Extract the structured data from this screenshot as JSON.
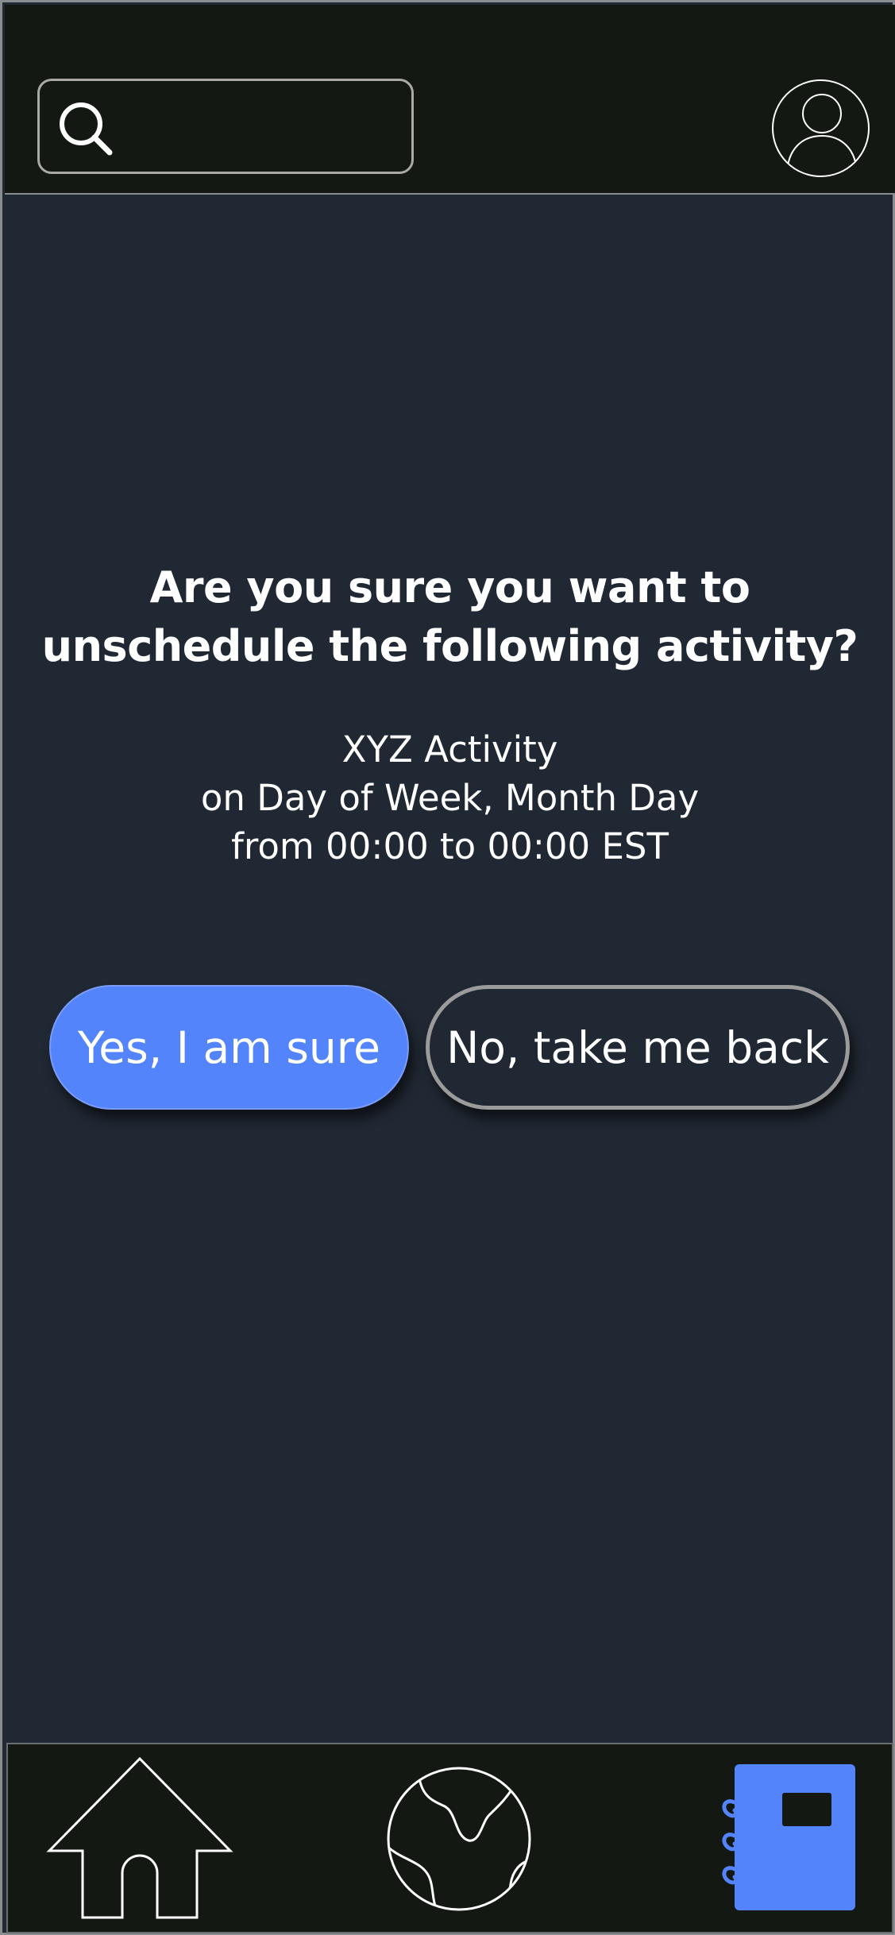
{
  "header": {
    "search": {
      "value": "",
      "placeholder": "",
      "icon": "search-icon"
    },
    "avatar_icon": "user-avatar-icon"
  },
  "dialog": {
    "title": "Are you sure you want to unschedule the following activity?",
    "details": {
      "activity": "XYZ Activity",
      "day": "on Day of Week, Month Day",
      "time": "from 00:00 to 00:00 EST"
    },
    "confirm_label": "Yes, I am sure",
    "cancel_label": "No, take me back"
  },
  "bottom_nav": {
    "items": [
      {
        "name": "home",
        "icon": "home-icon",
        "active": false
      },
      {
        "name": "explore",
        "icon": "globe-icon",
        "active": false
      },
      {
        "name": "schedule",
        "icon": "notebook-icon",
        "active": true
      }
    ]
  },
  "colors": {
    "background": "#202833",
    "bar": "#131812",
    "accent": "#5484fb",
    "text": "#ffffff"
  }
}
